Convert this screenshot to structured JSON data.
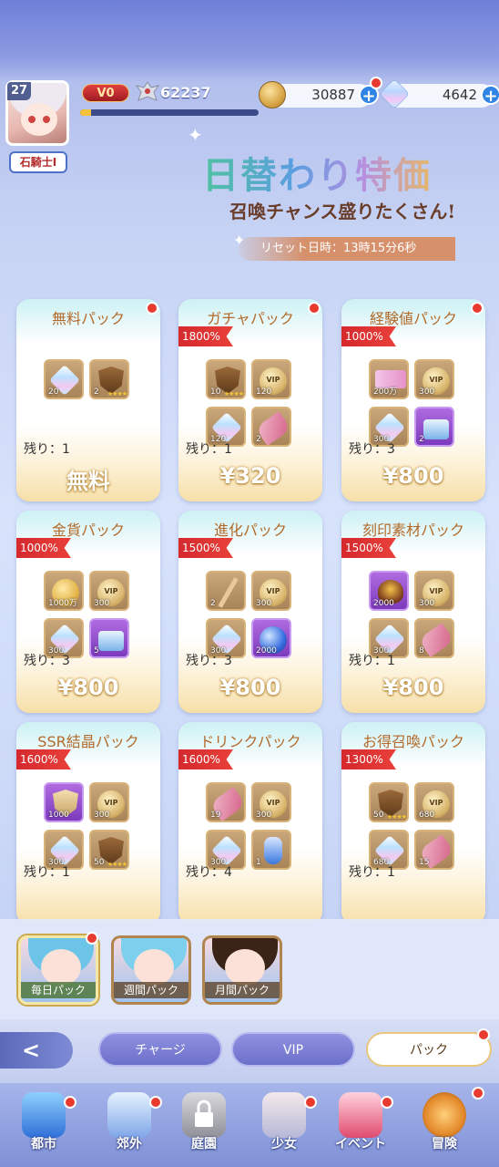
{
  "header": {
    "level": "27",
    "rank": "石騎士Ⅰ",
    "vip": "V0",
    "power": "62237",
    "exp_fraction": 0.06,
    "coins": "30887",
    "gems": "4642"
  },
  "banner": {
    "title": "日替わり特価",
    "subtitle": "召喚チャンス盛りたくさん!",
    "reset_label": "リセット日時：13時15分6秒"
  },
  "packs": [
    {
      "name": "無料パック",
      "badge": "",
      "remain": "残り：1",
      "price": "無料",
      "items": [
        {
          "kind": "gem",
          "qty": "20"
        },
        {
          "kind": "shield",
          "qty": "2",
          "stars": true
        }
      ]
    },
    {
      "name": "ガチャパック",
      "badge": "1800%",
      "remain": "残り：1",
      "price": "¥320",
      "items": [
        {
          "kind": "shield",
          "qty": "10",
          "stars": true
        },
        {
          "kind": "vip",
          "qty": "120"
        },
        {
          "kind": "gem",
          "qty": "120"
        },
        {
          "kind": "key",
          "qty": "2"
        }
      ]
    },
    {
      "name": "経験値パック",
      "badge": "1000%",
      "remain": "残り：3",
      "price": "¥800",
      "items": [
        {
          "kind": "ticket",
          "qty": "200万"
        },
        {
          "kind": "vip",
          "qty": "300"
        },
        {
          "kind": "gem",
          "qty": "300"
        },
        {
          "kind": "chest",
          "qty": "2",
          "purple": true
        }
      ]
    },
    {
      "name": "金貨パック",
      "badge": "1000%",
      "remain": "残り：3",
      "price": "¥800",
      "items": [
        {
          "kind": "gold",
          "qty": "1000万"
        },
        {
          "kind": "vip",
          "qty": "300"
        },
        {
          "kind": "gem",
          "qty": "300"
        },
        {
          "kind": "chest",
          "qty": "5",
          "purple": true
        }
      ]
    },
    {
      "name": "進化パック",
      "badge": "1500%",
      "remain": "残り：3",
      "price": "¥800",
      "items": [
        {
          "kind": "staff",
          "qty": "2"
        },
        {
          "kind": "vip",
          "qty": "300"
        },
        {
          "kind": "gem",
          "qty": "300"
        },
        {
          "kind": "orb",
          "qty": "2000",
          "purple": true
        }
      ]
    },
    {
      "name": "刻印素材パック",
      "badge": "1500%",
      "remain": "残り：1",
      "price": "¥800",
      "items": [
        {
          "kind": "pouch",
          "qty": "2000",
          "purple": true
        },
        {
          "kind": "vip",
          "qty": "300"
        },
        {
          "kind": "gem",
          "qty": "300"
        },
        {
          "kind": "key",
          "qty": "8"
        }
      ]
    },
    {
      "name": "SSR結晶パック",
      "badge": "1600%",
      "remain": "残り：1",
      "price": "",
      "items": [
        {
          "kind": "crest",
          "qty": "1000",
          "purple": true
        },
        {
          "kind": "vip",
          "qty": "300"
        },
        {
          "kind": "gem",
          "qty": "300"
        },
        {
          "kind": "shield",
          "qty": "50",
          "stars": true
        }
      ]
    },
    {
      "name": "ドリンクパック",
      "badge": "1600%",
      "remain": "残り：4",
      "price": "",
      "items": [
        {
          "kind": "key",
          "qty": "19"
        },
        {
          "kind": "vip",
          "qty": "300"
        },
        {
          "kind": "gem",
          "qty": "300"
        },
        {
          "kind": "potion",
          "qty": "1"
        }
      ]
    },
    {
      "name": "お得召喚パック",
      "badge": "1300%",
      "remain": "残り：1",
      "price": "",
      "items": [
        {
          "kind": "shield",
          "qty": "50",
          "stars": true
        },
        {
          "kind": "vip",
          "qty": "680"
        },
        {
          "kind": "gem",
          "qty": "680"
        },
        {
          "kind": "key",
          "qty": "15"
        }
      ]
    }
  ],
  "subtabs": [
    "毎日パック",
    "週間パック",
    "月間パック"
  ],
  "categories": [
    "チャージ",
    "VIP",
    "パック"
  ],
  "nav": [
    "都市",
    "郊外",
    "庭園",
    "少女",
    "イベント",
    "冒険"
  ]
}
